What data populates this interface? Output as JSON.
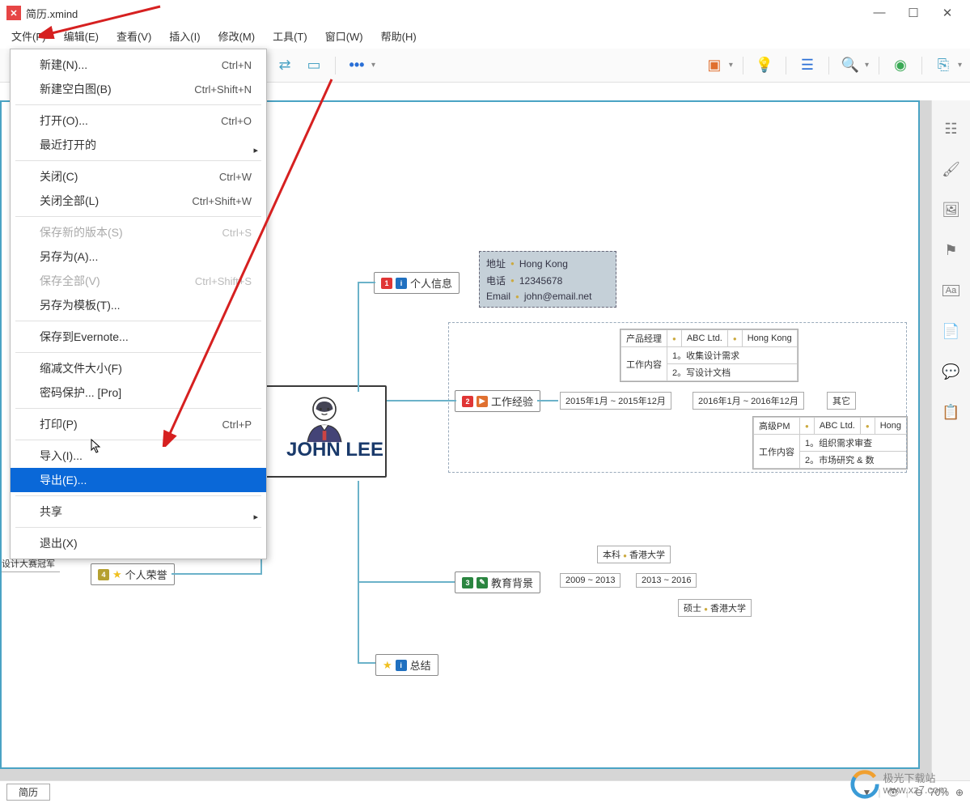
{
  "window": {
    "title": "简历.xmind",
    "min": "—",
    "max": "☐",
    "close": "✕"
  },
  "menubar": [
    "文件(F)",
    "编辑(E)",
    "查看(V)",
    "插入(I)",
    "修改(M)",
    "工具(T)",
    "窗口(W)",
    "帮助(H)"
  ],
  "filemenu": {
    "items": [
      {
        "label": "新建(N)...",
        "shortcut": "Ctrl+N",
        "disabled": false
      },
      {
        "label": "新建空白图(B)",
        "shortcut": "Ctrl+Shift+N",
        "disabled": false
      },
      {
        "sep": true
      },
      {
        "label": "打开(O)...",
        "shortcut": "Ctrl+O",
        "disabled": false
      },
      {
        "label": "最近打开的",
        "shortcut": "",
        "disabled": false,
        "submenu": true
      },
      {
        "sep": true
      },
      {
        "label": "关闭(C)",
        "shortcut": "Ctrl+W",
        "disabled": false
      },
      {
        "label": "关闭全部(L)",
        "shortcut": "Ctrl+Shift+W",
        "disabled": false
      },
      {
        "sep": true
      },
      {
        "label": "保存新的版本(S)",
        "shortcut": "Ctrl+S",
        "disabled": true
      },
      {
        "label": "另存为(A)...",
        "shortcut": "",
        "disabled": false
      },
      {
        "label": "保存全部(V)",
        "shortcut": "Ctrl+Shift+S",
        "disabled": true
      },
      {
        "label": "另存为模板(T)...",
        "shortcut": "",
        "disabled": false
      },
      {
        "sep": true
      },
      {
        "label": "保存到Evernote...",
        "shortcut": "",
        "disabled": false
      },
      {
        "sep": true
      },
      {
        "label": "缩减文件大小(F)",
        "shortcut": "",
        "disabled": false
      },
      {
        "label": "密码保护... [Pro]",
        "shortcut": "",
        "disabled": false
      },
      {
        "sep": true
      },
      {
        "label": "打印(P)",
        "shortcut": "Ctrl+P",
        "disabled": false
      },
      {
        "sep": true
      },
      {
        "label": "导入(I)...",
        "shortcut": "",
        "disabled": false
      },
      {
        "label": "导出(E)...",
        "shortcut": "",
        "disabled": false,
        "selected": true
      },
      {
        "sep": true
      },
      {
        "label": "共享",
        "shortcut": "",
        "disabled": false,
        "submenu": true
      },
      {
        "sep": true
      },
      {
        "label": "退出(X)",
        "shortcut": "",
        "disabled": false
      }
    ]
  },
  "mindmap": {
    "root": "JOHN LEE",
    "personal": {
      "title": "个人信息",
      "rows": [
        {
          "k": "地址",
          "v": "Hong Kong"
        },
        {
          "k": "电话",
          "v": "12345678"
        },
        {
          "k": "Email",
          "v": "john@email.net"
        }
      ]
    },
    "work": {
      "title": "工作经验",
      "period1": "2015年1月 ~ 2015年12月",
      "period2": "2016年1月 ~ 2016年12月",
      "other": "其它",
      "role1": "产品经理",
      "company1": "ABC Ltd.",
      "city1": "Hong Kong",
      "content_label": "工作内容",
      "tasks1": [
        "1。收集设计需求",
        "2。写设计文档"
      ],
      "role2": "高级PM",
      "company2": "ABC Ltd.",
      "city2": "Hong",
      "tasks2": [
        "1。组织需求审查",
        "2。市场研究 & 数"
      ]
    },
    "edu": {
      "title": "教育背景",
      "period1": "2009 ~ 2013",
      "period2": "2013 ~ 2016",
      "deg1": "本科",
      "uni1": "香港大学",
      "deg2": "硕士",
      "uni2": "香港大学"
    },
    "honor": {
      "title": "个人荣誉",
      "award": "设计大赛冠军"
    },
    "summary": {
      "title": "总结"
    }
  },
  "statusbar": {
    "tab": "简历",
    "zoom": "70%"
  },
  "watermark": "极光下载站\nwww.xz7.com"
}
